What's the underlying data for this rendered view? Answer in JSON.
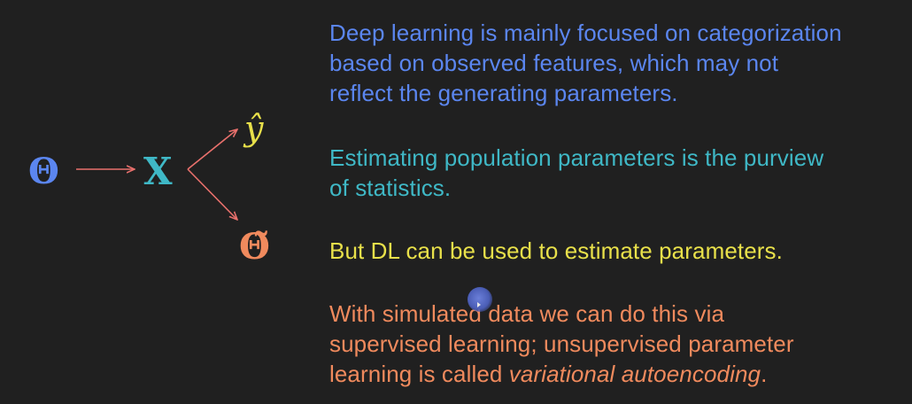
{
  "colors": {
    "background": "#202020",
    "blue": "#5b86f0",
    "teal": "#3fb8c6",
    "yellow": "#e8e04a",
    "orange": "#f08a5d",
    "arrow": "#e8706c"
  },
  "diagram": {
    "theta": "Θ",
    "x": "X",
    "y_hat": "ŷ",
    "theta_tilde": "Θ̃"
  },
  "paragraphs": {
    "p1": {
      "lines": [
        "Deep learning is mainly focused on categorization",
        "based on observed features, which may not",
        "reflect the generating parameters."
      ]
    },
    "p2": {
      "lines": [
        "Estimating population parameters is the purview",
        "of statistics."
      ]
    },
    "p3": {
      "lines": [
        "But DL can be used to estimate parameters."
      ]
    },
    "p4": {
      "line1": "With simulated data we can do this via",
      "line2": "supervised learning; unsupervised parameter",
      "line3_prefix": "learning is called ",
      "line3_italic": "variational autoencoding",
      "line3_suffix": "."
    }
  }
}
